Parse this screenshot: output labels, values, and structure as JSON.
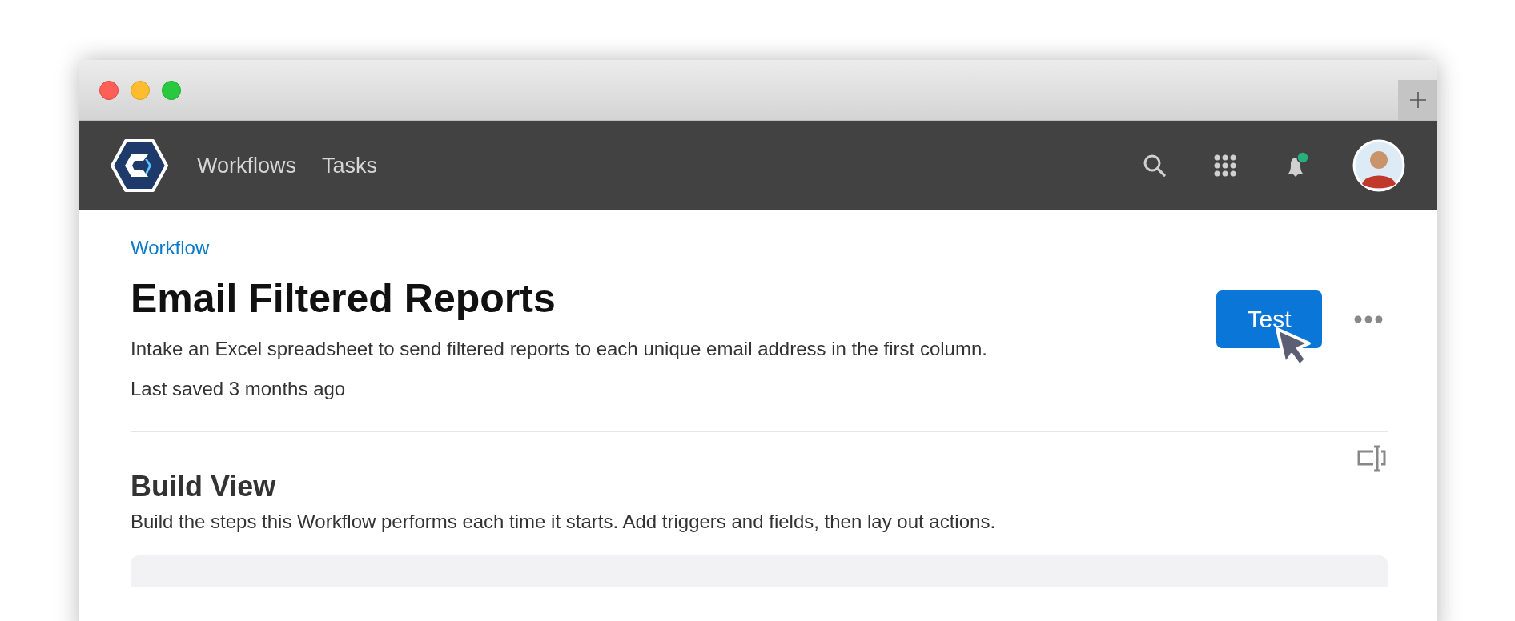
{
  "nav": {
    "items": [
      {
        "label": "Workflows"
      },
      {
        "label": "Tasks"
      }
    ],
    "notifications": {
      "unread": true
    }
  },
  "header": {
    "breadcrumb": "Workflow",
    "title": "Email Filtered Reports",
    "description": "Intake an Excel spreadsheet to send filtered reports to each unique email address in the first column.",
    "saved": "Last saved 3 months ago",
    "button": "Test"
  },
  "section": {
    "title": "Build View",
    "description": "Build the steps this Workflow performs each time it starts. Add triggers and fields, then lay out actions."
  }
}
